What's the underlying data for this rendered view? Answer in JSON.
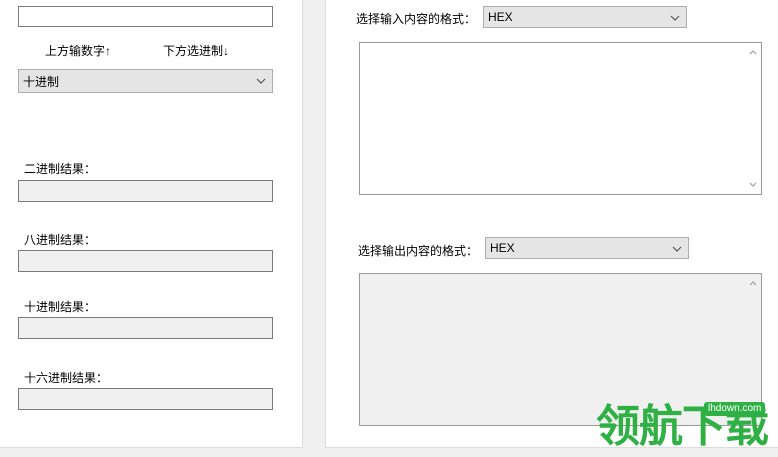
{
  "left": {
    "top_input_value": "",
    "up_label": "上方输数字↑",
    "down_label": "下方选进制↓",
    "base_select": "十进制",
    "binary_label": "二进制结果：",
    "binary_value": "",
    "octal_label": "八进制结果：",
    "octal_value": "",
    "decimal_label": "十进制结果：",
    "decimal_value": "",
    "hex_label": "十六进制结果：",
    "hex_value": ""
  },
  "right": {
    "input_format_label": "选择输入内容的格式：",
    "input_format_select": "HEX",
    "input_text": "",
    "output_format_label": "选择输出内容的格式：",
    "output_format_select": "HEX",
    "output_text": ""
  },
  "watermark": {
    "text": "领航下载",
    "url": "lhdown.com",
    "color": "#2fb044"
  }
}
